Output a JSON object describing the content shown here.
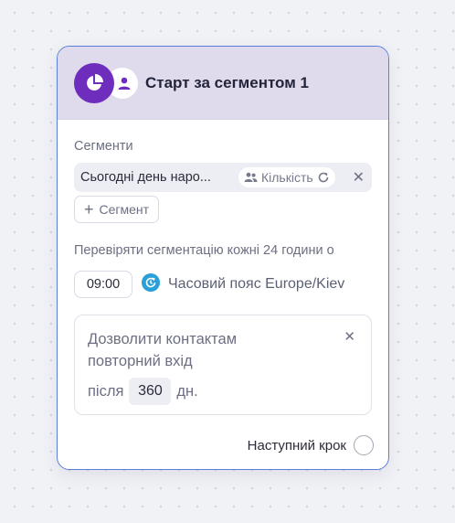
{
  "node": {
    "title": "Старт за сегментом 1",
    "icons": [
      "pie-chart-icon",
      "user-icon"
    ]
  },
  "segments": {
    "label": "Сегменти",
    "items": [
      {
        "name": "Сьогодні день наро...",
        "count_label": "Кількість"
      }
    ],
    "add_label": "Сегмент"
  },
  "schedule": {
    "check_label": "Перевіряти сегментацію кожні 24 години о",
    "time": "09:00",
    "timezone_text": "Часовий пояс Europe/Kiev"
  },
  "reentry": {
    "text": "Дозволити контактам повторний вхід",
    "after_label": "після",
    "days": "360",
    "days_unit": "дн."
  },
  "next_step": {
    "label": "Наступний крок"
  },
  "colors": {
    "accent": "#6f2dbd",
    "header_bg": "#e0dbec",
    "border": "#5b7fd6",
    "timezone_icon": "#2a9fd8"
  }
}
